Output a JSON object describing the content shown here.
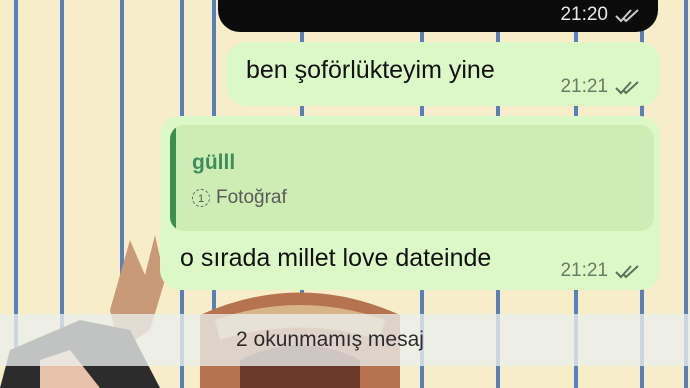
{
  "messages": {
    "top_time": "21:20",
    "m1": {
      "text": "ben şoförlükteyim yine",
      "time": "21:21"
    },
    "m2": {
      "reply_name": "gülll",
      "reply_type": "Fotoğraf",
      "once_icon_label": "1",
      "text": "o sırada millet love dateinde",
      "time": "21:21"
    }
  },
  "unread_banner": "2 okunmamış mesaj",
  "colors": {
    "bubble_out": "#dcf8c6",
    "reply_accent": "#3a8f4f",
    "wallpaper": "#f7eec9",
    "stripe": "#3e6cb8"
  },
  "icons": {
    "read_receipt": "double-check-icon",
    "view_once": "view-once-icon"
  }
}
